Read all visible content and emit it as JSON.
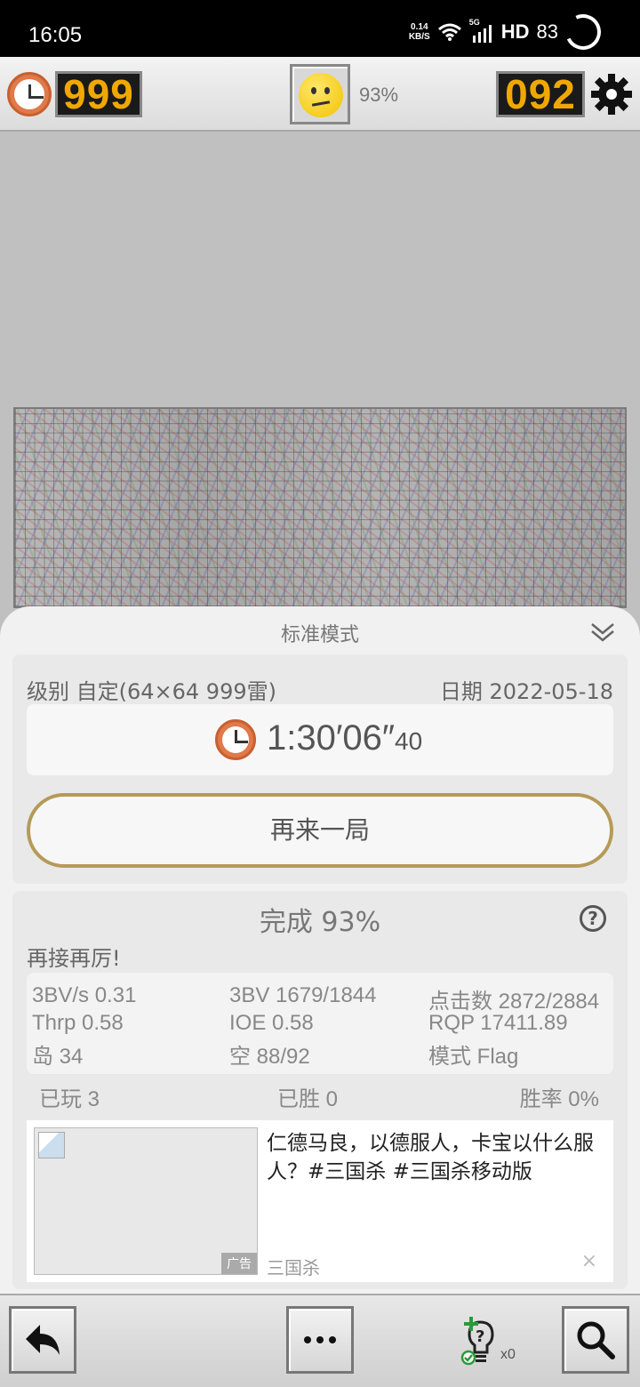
{
  "status_bar": {
    "time": "16:05",
    "net_speed_value": "0.14",
    "net_speed_unit": "KB/S",
    "signal": "5G",
    "hd": "HD",
    "battery": "83"
  },
  "game_header": {
    "timer_value": "999",
    "completion_pct": "93%",
    "mines_value": "092",
    "colors": {
      "lcd_bg": "#1a1a1a",
      "lcd_digit": "#f0a800"
    }
  },
  "result": {
    "mode_title": "标准模式",
    "level_text": "级别 自定(64×64  999雷)",
    "date_text": "日期 2022-05-18",
    "time_main": "1:30′06″",
    "time_frac": "40",
    "again_button": "再来一局",
    "complete_text": "完成 93%",
    "encourage_text": "再接再厉!",
    "stats": {
      "bv_per_s": "3BV/s 0.31",
      "bv": "3BV 1679/1844",
      "clicks": "点击数 2872/2884",
      "thrp": "Thrp 0.58",
      "ioe": "IOE 0.58",
      "rqp": "RQP 17411.89",
      "islands": "岛 34",
      "openings": "空 88/92",
      "mode": "模式 Flag"
    },
    "played": "已玩 3",
    "won": "已胜 0",
    "win_rate": "胜率 0%"
  },
  "ad": {
    "text": "仁德马良，以德服人，卡宝以什么服人？#三国杀 #三国杀移动版",
    "badge": "广告",
    "source": "三国杀",
    "close": "×"
  },
  "toolbar": {
    "hint_count": "x0"
  }
}
